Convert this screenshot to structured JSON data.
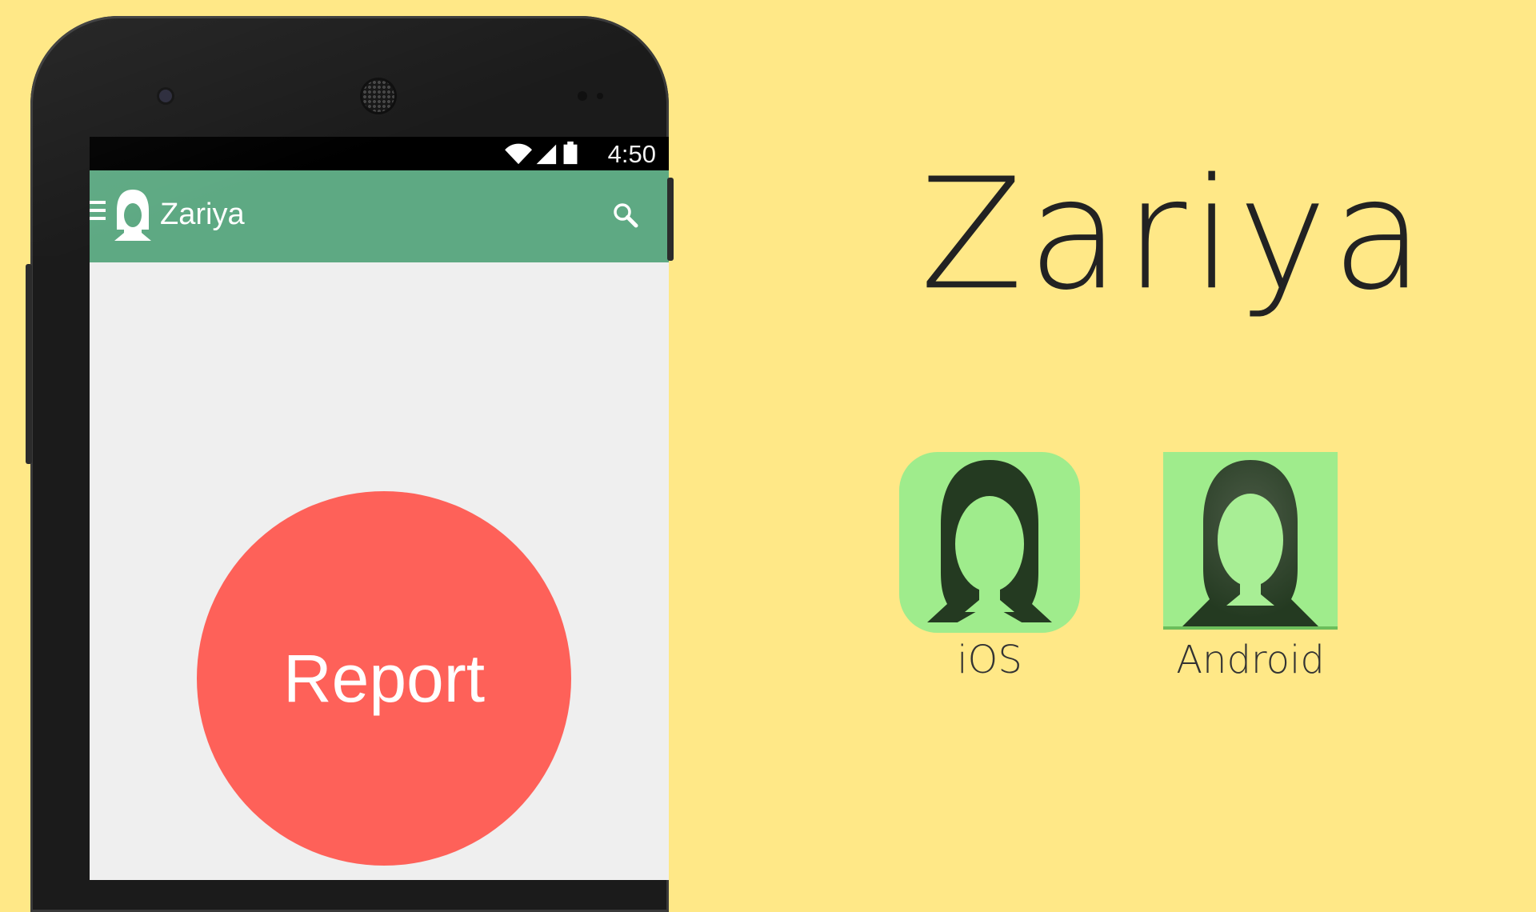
{
  "status_bar": {
    "time": "4:50",
    "icons": [
      "wifi-icon",
      "signal-icon",
      "battery-icon"
    ]
  },
  "app_bar": {
    "title": "Zariya",
    "menu_icon": "hamburger-menu-icon",
    "logo_icon": "woman-silhouette-icon",
    "search_icon": "search-icon"
  },
  "main": {
    "report_label": "Report"
  },
  "branding": {
    "title": "Zariya",
    "platforms": [
      {
        "label": "iOS",
        "icon": "ios-app-icon"
      },
      {
        "label": "Android",
        "icon": "android-app-icon"
      }
    ]
  },
  "colors": {
    "background": "#ffe887",
    "app_bar": "#5ea983",
    "report_button": "#fe6159",
    "icon_green": "#9fec8c",
    "icon_dark": "#243a21"
  }
}
